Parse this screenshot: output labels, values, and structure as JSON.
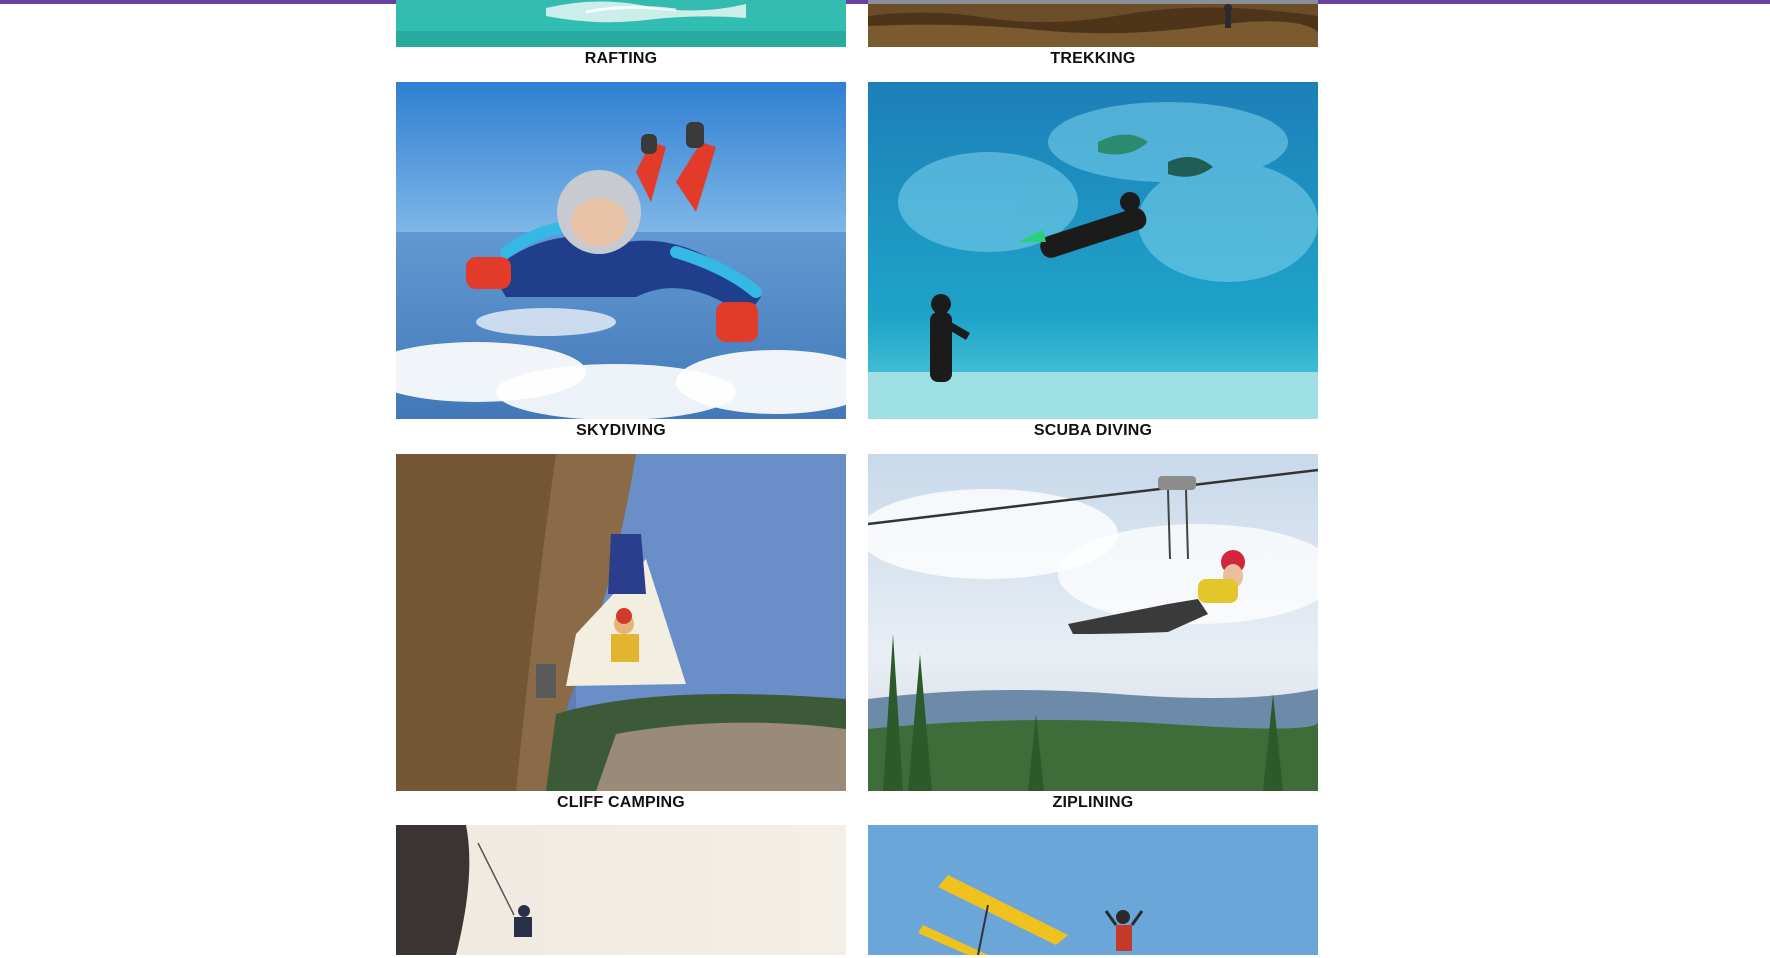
{
  "gallery": {
    "cards": [
      {
        "label": "RAFTING",
        "image": "rafting-photo"
      },
      {
        "label": "TREKKING",
        "image": "trekking-photo"
      },
      {
        "label": "SKYDIVING",
        "image": "skydiving-photo"
      },
      {
        "label": "SCUBA DIVING",
        "image": "scuba-diving-photo"
      },
      {
        "label": "CLIFF CAMPING",
        "image": "cliff-camping-photo"
      },
      {
        "label": "ZIPLINING",
        "image": "ziplining-photo"
      },
      {
        "label": "",
        "image": "rock-climbing-photo"
      },
      {
        "label": "",
        "image": "hang-gliding-photo"
      }
    ]
  },
  "colors": {
    "accent": "#6b3fa0",
    "caption_text": "#111111",
    "background": "#ffffff"
  }
}
